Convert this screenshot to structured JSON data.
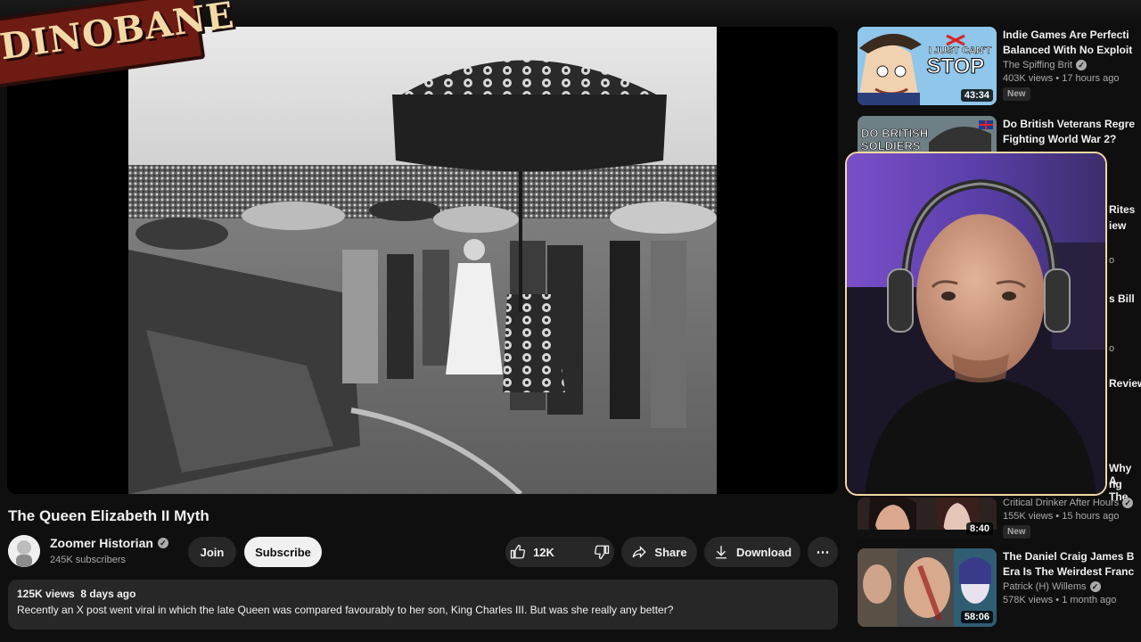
{
  "logo": {
    "text": "DINOBANE"
  },
  "video": {
    "title": "The Queen Elizabeth II Myth",
    "channel": "Zoomer Historian",
    "subscribers": "245K subscribers",
    "join_label": "Join",
    "subscribe_label": "Subscribe",
    "likes": "12K",
    "share_label": "Share",
    "download_label": "Download",
    "more_label": "⋯",
    "views": "125K views",
    "age": "8 days ago",
    "description": "Recently an X post went viral in which the late Queen was compared favourably to her son, King Charles III. But was she really any better?"
  },
  "sidebar": [
    {
      "title_1": "Indie Games Are Perfecti",
      "title_2": "Balanced With No Exploit",
      "channel": "The Spiffing Brit",
      "stats": "403K views • 17 hours ago",
      "badge": "New",
      "duration": "43:34",
      "thumb_text_1": "I JUST CAN'T",
      "thumb_text_2": "STOP"
    },
    {
      "title_1": "Do British Veterans Regre",
      "title_2": "Fighting World War 2?",
      "thumb_text_1": "DO BRITISH",
      "thumb_text_2": "SOLDIERS"
    },
    {
      "channel": "Critical Drinker After Hours",
      "stats": "155K views • 15 hours ago",
      "badge": "New",
      "duration": "8:40"
    },
    {
      "title_1": "The Daniel Craig James B",
      "title_2": "Era Is The Weirdest Franc",
      "channel": "Patrick (H) Willems",
      "stats": "578K views • 1 month ago",
      "duration": "58:06"
    }
  ],
  "fragments": {
    "f1": "Rites",
    "f2": "iew",
    "f3": "o",
    "f4": "s Bill",
    "f5": "o",
    "f6": "Review",
    "f7": "Why A",
    "f8": "ng The"
  },
  "icons": {
    "like": "thumbs-up-icon",
    "dislike": "thumbs-down-icon",
    "share": "share-arrow-icon",
    "download": "download-icon",
    "more": "more-dots-icon",
    "verified": "verified-check-icon"
  }
}
